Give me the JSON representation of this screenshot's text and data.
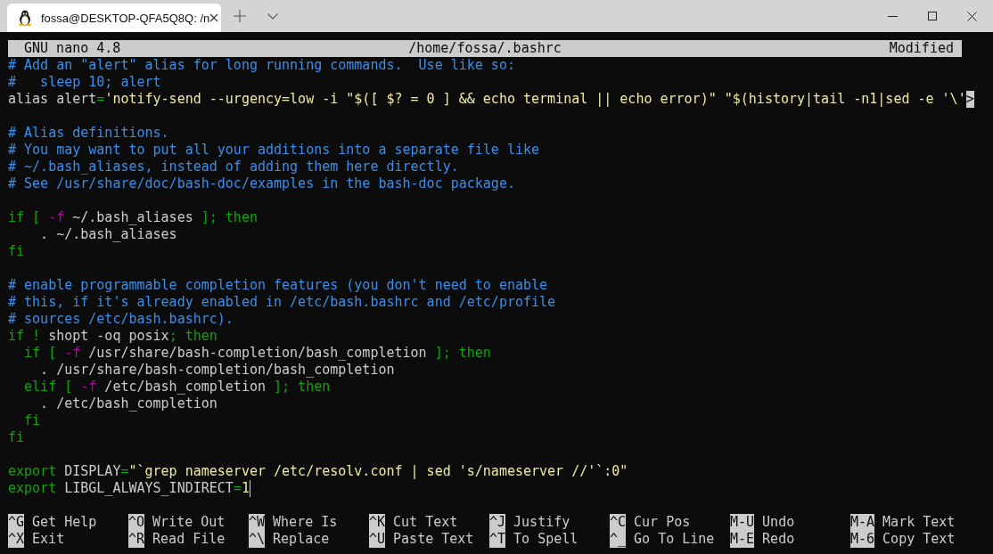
{
  "window": {
    "tabs": [
      {
        "title": "fossa@DESKTOP-QFA5Q8Q: /n",
        "selected": true
      }
    ]
  },
  "nano": {
    "header": {
      "version": "GNU nano 4.8",
      "file": "/home/fossa/.bashrc",
      "status": "Modified"
    },
    "lines": [
      {
        "kind": "code",
        "segments": [
          {
            "kind": "comment",
            "text": "# Add an \"alert\" alias for long running commands.  Use like so:"
          }
        ]
      },
      {
        "kind": "code",
        "segments": [
          {
            "kind": "comment",
            "text": "#   sleep 10; alert"
          }
        ]
      },
      {
        "kind": "code",
        "segments": [
          {
            "kind": "plain",
            "text": "alias alert"
          },
          {
            "kind": "keyword",
            "text": "="
          },
          {
            "kind": "string",
            "text": "'notify-send --urgency=low -i \"$([ $? = 0 ] && echo terminal || echo error)\" \"$(history|tail -n1|sed -e '\\'"
          }
        ],
        "overflow": ">"
      },
      {
        "kind": "blank"
      },
      {
        "kind": "code",
        "segments": [
          {
            "kind": "comment",
            "text": "# Alias definitions."
          }
        ]
      },
      {
        "kind": "code",
        "segments": [
          {
            "kind": "comment",
            "text": "# You may want to put all your additions into a separate file like"
          }
        ]
      },
      {
        "kind": "code",
        "segments": [
          {
            "kind": "comment",
            "text": "# ~/.bash_aliases, instead of adding them here directly."
          }
        ]
      },
      {
        "kind": "code",
        "segments": [
          {
            "kind": "comment",
            "text": "# See /usr/share/doc/bash-doc/examples in the bash-doc package."
          }
        ]
      },
      {
        "kind": "blank"
      },
      {
        "kind": "code",
        "segments": [
          {
            "kind": "keyword",
            "text": "if [ "
          },
          {
            "kind": "flag",
            "text": "-f"
          },
          {
            "kind": "plain",
            "text": " ~/.bash_aliases "
          },
          {
            "kind": "keyword",
            "text": "]; then"
          }
        ]
      },
      {
        "kind": "code",
        "segments": [
          {
            "kind": "plain",
            "text": "    . ~/.bash_aliases"
          }
        ]
      },
      {
        "kind": "code",
        "segments": [
          {
            "kind": "keyword",
            "text": "fi"
          }
        ]
      },
      {
        "kind": "blank"
      },
      {
        "kind": "code",
        "segments": [
          {
            "kind": "comment",
            "text": "# enable programmable completion features (you don't need to enable"
          }
        ]
      },
      {
        "kind": "code",
        "segments": [
          {
            "kind": "comment",
            "text": "# this, if it's already enabled in /etc/bash.bashrc and /etc/profile"
          }
        ]
      },
      {
        "kind": "code",
        "segments": [
          {
            "kind": "comment",
            "text": "# sources /etc/bash.bashrc)."
          }
        ]
      },
      {
        "kind": "code",
        "segments": [
          {
            "kind": "keyword",
            "text": "if ! "
          },
          {
            "kind": "plain",
            "text": "shopt -oq posix"
          },
          {
            "kind": "keyword",
            "text": "; then"
          }
        ]
      },
      {
        "kind": "code",
        "segments": [
          {
            "kind": "keyword",
            "text": "  if [ "
          },
          {
            "kind": "flag",
            "text": "-f"
          },
          {
            "kind": "plain",
            "text": " /usr/share/bash-completion/bash_completion "
          },
          {
            "kind": "keyword",
            "text": "]; then"
          }
        ]
      },
      {
        "kind": "code",
        "segments": [
          {
            "kind": "plain",
            "text": "    . /usr/share/bash-completion/bash_completion"
          }
        ]
      },
      {
        "kind": "code",
        "segments": [
          {
            "kind": "keyword",
            "text": "  elif [ "
          },
          {
            "kind": "flag",
            "text": "-f"
          },
          {
            "kind": "plain",
            "text": " /etc/bash_completion "
          },
          {
            "kind": "keyword",
            "text": "]; then"
          }
        ]
      },
      {
        "kind": "code",
        "segments": [
          {
            "kind": "plain",
            "text": "    . /etc/bash_completion"
          }
        ]
      },
      {
        "kind": "code",
        "segments": [
          {
            "kind": "keyword",
            "text": "  fi"
          }
        ]
      },
      {
        "kind": "code",
        "segments": [
          {
            "kind": "keyword",
            "text": "fi"
          }
        ]
      },
      {
        "kind": "blank"
      },
      {
        "kind": "code",
        "segments": [
          {
            "kind": "keyword",
            "text": "export"
          },
          {
            "kind": "plain",
            "text": " DISPLAY"
          },
          {
            "kind": "keyword",
            "text": "="
          },
          {
            "kind": "string",
            "text": "\"`grep nameserver /etc/resolv.conf | sed 's/nameserver //'`:0\""
          }
        ]
      },
      {
        "kind": "code",
        "segments": [
          {
            "kind": "keyword",
            "text": "export"
          },
          {
            "kind": "plain",
            "text": " LIBGL_ALWAYS_INDIRECT"
          },
          {
            "kind": "keyword",
            "text": "="
          },
          {
            "kind": "string",
            "text": "1"
          }
        ],
        "cursor": true
      },
      {
        "kind": "blank"
      }
    ],
    "shortcuts": [
      [
        {
          "key": "^G",
          "label": "Get Help"
        },
        {
          "key": "^O",
          "label": "Write Out"
        },
        {
          "key": "^W",
          "label": "Where Is"
        },
        {
          "key": "^K",
          "label": "Cut Text"
        },
        {
          "key": "^J",
          "label": "Justify"
        },
        {
          "key": "^C",
          "label": "Cur Pos"
        },
        {
          "key": "M-U",
          "label": "Undo"
        },
        {
          "key": "M-A",
          "label": "Mark Text"
        }
      ],
      [
        {
          "key": "^X",
          "label": "Exit"
        },
        {
          "key": "^R",
          "label": "Read File"
        },
        {
          "key": "^\\",
          "label": "Replace"
        },
        {
          "key": "^U",
          "label": "Paste Text"
        },
        {
          "key": "^T",
          "label": "To Spell"
        },
        {
          "key": "^_",
          "label": "Go To Line"
        },
        {
          "key": "M-E",
          "label": "Redo"
        },
        {
          "key": "M-6",
          "label": "Copy Text"
        }
      ]
    ]
  }
}
